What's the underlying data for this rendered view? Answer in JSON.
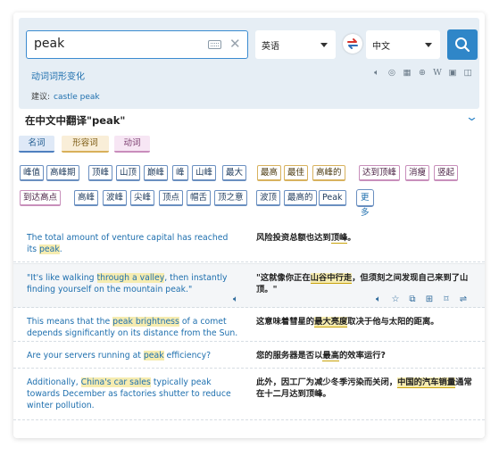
{
  "search": {
    "query": "peak",
    "source_lang": "英语",
    "target_lang": "中文",
    "inflections_link": "动词词形变化",
    "suggestion_label": "建议:",
    "suggestion_value": "castle peak"
  },
  "tool_icons": [
    "speaker-icon",
    "speech-bubble-icon",
    "table-icon",
    "globe-icon",
    "wikipedia-icon",
    "image-icon",
    "book-icon"
  ],
  "translation_heading": "在中文中翻译\"peak\"",
  "pos_tags": {
    "noun": "名词",
    "adjective": "形容词",
    "verb": "动词"
  },
  "translations": [
    {
      "text": "峰值",
      "pos": "noun"
    },
    {
      "text": "高峰期",
      "pos": "noun"
    },
    {
      "text": "顶峰",
      "pos": "noun"
    },
    {
      "text": "山顶",
      "pos": "noun"
    },
    {
      "text": "巅峰",
      "pos": "noun"
    },
    {
      "text": "峰",
      "pos": "noun"
    },
    {
      "text": "山峰",
      "pos": "noun"
    },
    {
      "text": "最大",
      "pos": "noun"
    },
    {
      "text": "最高",
      "pos": "adj"
    },
    {
      "text": "最佳",
      "pos": "adj"
    },
    {
      "text": "高峰的",
      "pos": "adj"
    },
    {
      "text": "达到顶峰",
      "pos": "verb"
    },
    {
      "text": "消瘦",
      "pos": "verb"
    },
    {
      "text": "竖起",
      "pos": "verb"
    },
    {
      "text": "到达高点",
      "pos": "verb"
    },
    {
      "text": "高峰",
      "pos": "noun"
    },
    {
      "text": "波峰",
      "pos": "noun"
    },
    {
      "text": "尖峰",
      "pos": "noun"
    },
    {
      "text": "顶点",
      "pos": "noun"
    },
    {
      "text": "帽舌",
      "pos": "noun"
    },
    {
      "text": "顶之意",
      "pos": "noun"
    },
    {
      "text": "波顶",
      "pos": "noun"
    },
    {
      "text": "最高的",
      "pos": "noun"
    },
    {
      "text": "Peak",
      "pos": "noun"
    }
  ],
  "more_label": "更多",
  "examples": [
    {
      "src": [
        "The total amount of venture capital has reached its ",
        {
          "h": "peak"
        },
        "."
      ],
      "tgt": [
        "风险投资总额也达到",
        {
          "u": "顶峰"
        },
        "。"
      ]
    },
    {
      "src": [
        "\"It's like walking ",
        {
          "h": "through a valley"
        },
        ", then instantly finding yourself on the mountain peak.\""
      ],
      "tgt": [
        "\"这就像你正在",
        {
          "hu": "山谷中行走"
        },
        "，但须刻之间发现自己来到了山顶。\""
      ]
    },
    {
      "src": [
        "This means that the ",
        {
          "h": "peak brightness"
        },
        " of a comet depends significantly on its distance from the Sun."
      ],
      "tgt": [
        "这意味着彗星的",
        {
          "hu": "最大亮度"
        },
        "取决于他与太阳的距离。"
      ]
    },
    {
      "src": [
        "Are your servers running at ",
        {
          "h": "peak"
        },
        " efficiency?"
      ],
      "tgt": [
        "您的服务器是否以",
        {
          "u": "最高"
        },
        "的效率运行?"
      ]
    },
    {
      "src": [
        "Additionally, ",
        {
          "h": "China's car sales"
        },
        " typically peak towards December as factories shutter to reduce winter pollution."
      ],
      "tgt": [
        "此外，因工厂为减少冬季污染而关闭，",
        {
          "hu": "中国的汽车销量"
        },
        "通常在十二月达到顶峰。"
      ]
    }
  ],
  "colors": {
    "accent": "#2f86c8",
    "link": "#1e6fae",
    "panel": "#e6eef5",
    "highlight": "#f6ecb0"
  }
}
